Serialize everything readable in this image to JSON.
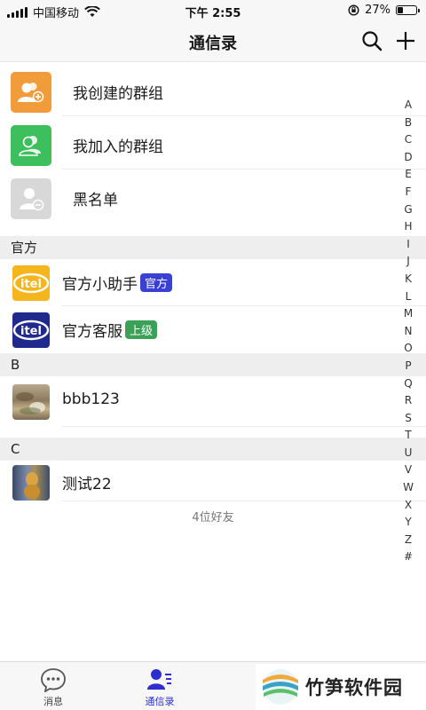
{
  "status_bar": {
    "carrier": "中国移动",
    "time": "下午 2:55",
    "battery_percent": "27%",
    "battery_level": 0.27
  },
  "nav": {
    "title": "通信录",
    "search_icon": "search-icon",
    "add_icon": "plus-icon"
  },
  "groups": [
    {
      "label": "我创建的群组",
      "icon": "group-add-icon",
      "color": "#f29b3a"
    },
    {
      "label": "我加入的群组",
      "icon": "group-icon",
      "color": "#3dbf5e"
    },
    {
      "label": "黑名单",
      "icon": "blocked-user-icon",
      "color": "#d8d8d8"
    }
  ],
  "sections": [
    {
      "header": "官方",
      "contacts": [
        {
          "name": "官方小助手",
          "tag": "官方",
          "tag_color": "#3a3fd6",
          "avatar": "itel-logo-yellow"
        },
        {
          "name": "官方客服",
          "tag": "上级",
          "tag_color": "#3aa157",
          "avatar": "itel-logo-blue"
        }
      ]
    },
    {
      "header": "B",
      "contacts": [
        {
          "name": "bbb123",
          "avatar": "photo-avatar"
        }
      ]
    },
    {
      "header": "C",
      "contacts": [
        {
          "name": "测试22",
          "avatar": "photo-avatar"
        }
      ]
    }
  ],
  "friend_count": "4位好友",
  "alpha_index": [
    "A",
    "B",
    "C",
    "D",
    "E",
    "F",
    "G",
    "H",
    "I",
    "J",
    "K",
    "L",
    "M",
    "N",
    "O",
    "P",
    "Q",
    "R",
    "S",
    "T",
    "U",
    "V",
    "W",
    "X",
    "Y",
    "Z",
    "#"
  ],
  "tabs": [
    {
      "label": "消息",
      "icon": "chat-bubble-icon",
      "active": false
    },
    {
      "label": "通信录",
      "icon": "contacts-icon",
      "active": true
    }
  ],
  "colors": {
    "accent": "#2f2fd0",
    "tag_official": "#3a3fd6",
    "tag_superior": "#3aa157"
  },
  "watermark": {
    "text": "竹笋软件园"
  }
}
